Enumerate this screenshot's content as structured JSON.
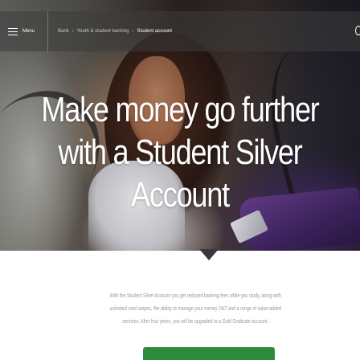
{
  "nav": {
    "menu_label": "Menu",
    "breadcrumbs": [
      "Bank",
      "Youth & student banking",
      "Student account"
    ]
  },
  "hero": {
    "headline_lines": [
      "Make money go further",
      "with a Student Silver",
      "Account"
    ]
  },
  "intro": {
    "lines": [
      "With the Student Silver Account you get reduced banking fees while you study, along with",
      "unlimited card swipes, the ability to manage your money 24/7 and a range of value-added",
      "services. After four years, you will be upgraded to a Gold Graduate account."
    ]
  },
  "colors": {
    "cta": "#2e8b3c",
    "body_text": "#9a9a9a",
    "topbar": "#3c3c3c"
  }
}
